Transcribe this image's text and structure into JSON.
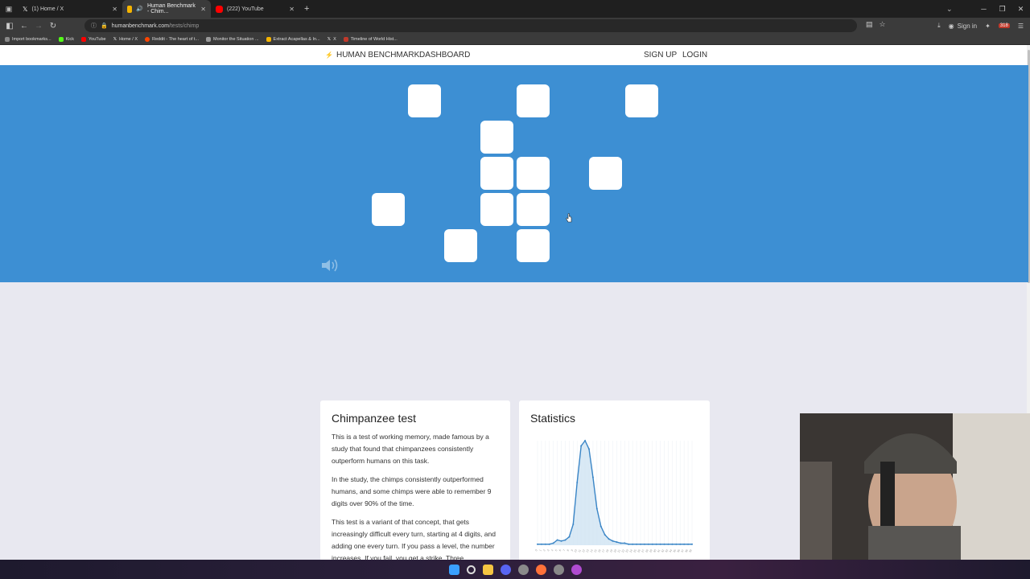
{
  "browser": {
    "tabs": [
      {
        "label": "(1) Home / X",
        "favicon": "x-logo-icon"
      },
      {
        "label": "Human Benchmark - Chim...",
        "favicon": "human-benchmark-icon",
        "active": true
      },
      {
        "label": "(222) YouTube",
        "favicon": "youtube-icon"
      }
    ],
    "new_tab": "+",
    "url": "humanbenchmark.com/tests/chimp",
    "url_host": "humanbenchmark.com",
    "url_path": "/tests/chimp",
    "sign_in_label": "Sign in",
    "extension_badge": "318",
    "bookmarks": [
      {
        "label": "Import bookmarks...",
        "color": "#888888"
      },
      {
        "label": "Kick",
        "color": "#53fc18"
      },
      {
        "label": "YouTube",
        "color": "#ff0000"
      },
      {
        "label": "Home / X",
        "color": "#000000"
      },
      {
        "label": "Reddit - The heart of t...",
        "color": "#ff4500"
      },
      {
        "label": "Monitor the Situation ...",
        "color": "#999999"
      },
      {
        "label": "Extract Acapellas & In...",
        "color": "#f5b400"
      },
      {
        "label": "X",
        "color": "#000000"
      },
      {
        "label": "Timeline of World Hist...",
        "color": "#c0392b"
      }
    ]
  },
  "site": {
    "brand": "HUMAN BENCHMARK",
    "dashboard": "DASHBOARD",
    "sign_up": "SIGN UP",
    "login": "LOGIN",
    "game_bg": "#3d8fd3",
    "tiles_count": 12
  },
  "info_card": {
    "title": "Chimpanzee test",
    "paragraphs": [
      "This is a test of working memory, made famous by a study that found that chimpanzees consistently outperform humans on this task.",
      "In the study, the chimps consistently outperformed humans, and some chimps were able to remember 9 digits over 90% of the time.",
      "This test is a variant of that concept, that gets increasingly difficult every turn, starting at 4 digits, and adding one every turn. If you pass a level, the number increases. If you fail, you get a strike. Three"
    ]
  },
  "stats_card": {
    "title": "Statistics"
  },
  "chart_data": {
    "type": "area",
    "title": "Statistics",
    "x": [
      0,
      1,
      2,
      3,
      4,
      5,
      6,
      7,
      8,
      9,
      10,
      11,
      12,
      13,
      14,
      15,
      16,
      17,
      18,
      19,
      20,
      21,
      22,
      23,
      24,
      25,
      26,
      27,
      28,
      29,
      30,
      31,
      32,
      33,
      34,
      35,
      36,
      37,
      38,
      39
    ],
    "values": [
      1,
      1,
      1,
      1,
      2,
      5,
      4,
      5,
      8,
      20,
      60,
      95,
      100,
      92,
      65,
      35,
      18,
      10,
      6,
      4,
      3,
      2,
      2,
      1,
      1,
      1,
      1,
      1,
      1,
      1,
      1,
      1,
      1,
      1,
      1,
      1,
      1,
      1,
      1,
      1
    ],
    "color": "#3a85c6",
    "fill": "#cfe3f3"
  },
  "taskbar": {
    "icons": [
      "windows-start-icon",
      "search-icon",
      "file-explorer-icon",
      "discord-icon",
      "settings-icon",
      "firefox-icon",
      "chrome-icon",
      "obs-icon"
    ]
  }
}
